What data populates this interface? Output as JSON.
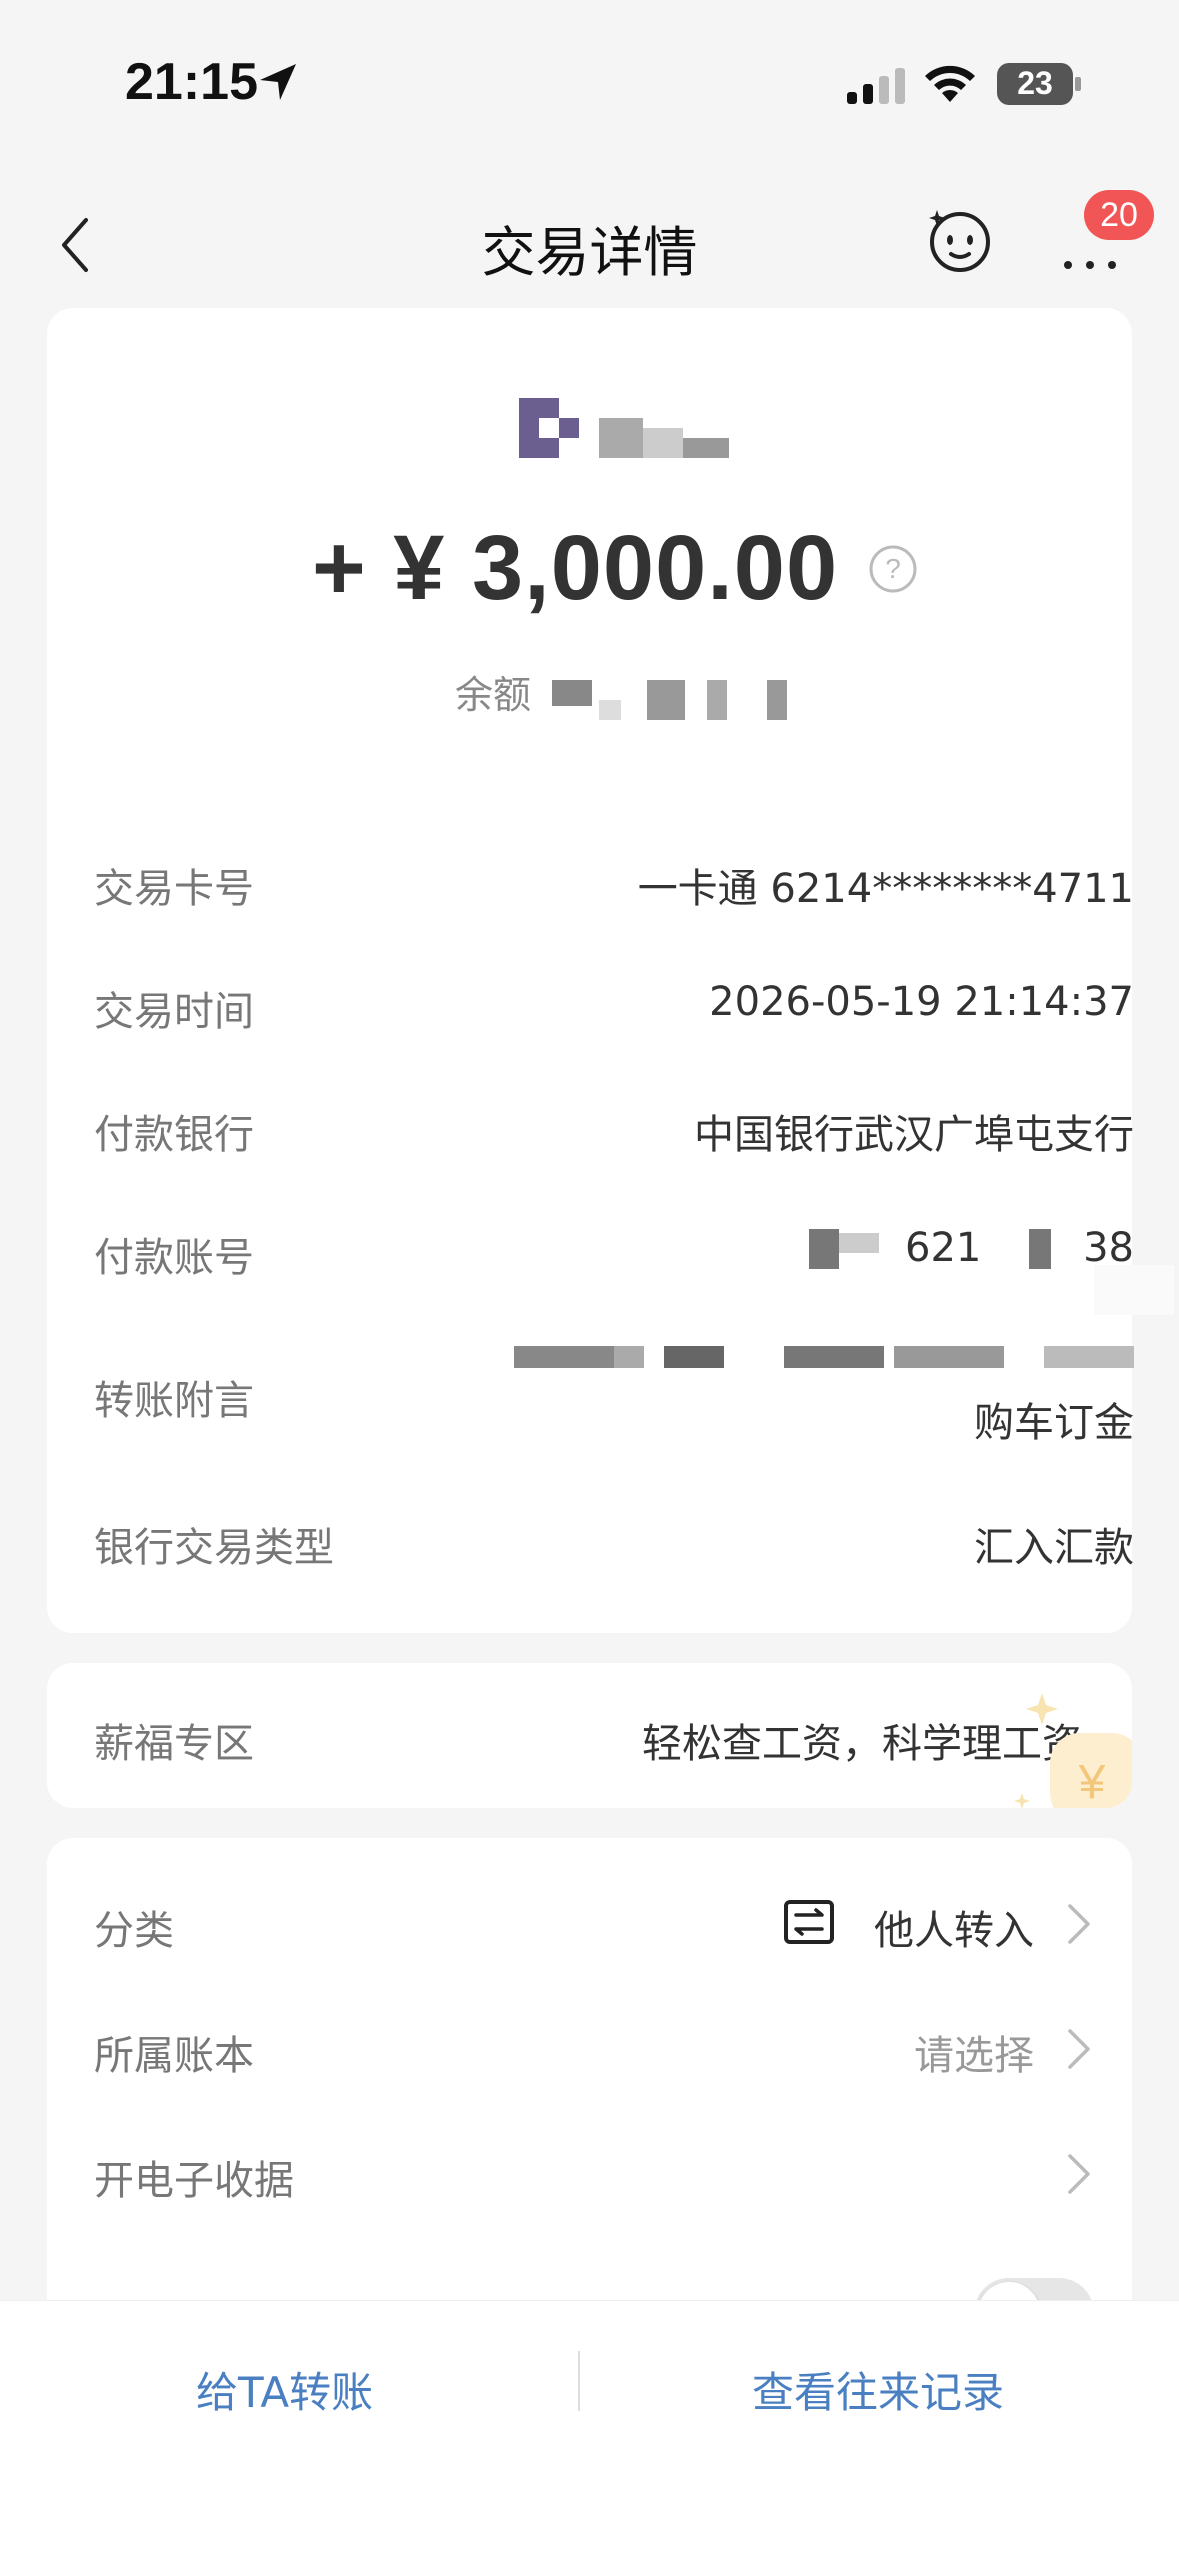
{
  "status_bar": {
    "time": "21:15",
    "battery": "23"
  },
  "nav": {
    "title": "交易详情",
    "badge_count": "20"
  },
  "transaction": {
    "amount": "+ ¥ 3,000.00",
    "balance_label": "余额",
    "details": [
      {
        "label": "交易卡号",
        "value": "一卡通 6214********4711"
      },
      {
        "label": "交易时间",
        "value": "2026-05-19 21:14:37"
      },
      {
        "label": "付款银行",
        "value": "中国银行武汉广埠屯支行"
      },
      {
        "label": "付款账号",
        "value": "621        38"
      },
      {
        "label": "转账附言",
        "value": "购车订金"
      },
      {
        "label": "银行交易类型",
        "value": "汇入汇款"
      }
    ]
  },
  "salary": {
    "label": "薪福专区",
    "value": "轻松查工资，科学理工资"
  },
  "options": {
    "category_label": "分类",
    "category_value": "他人转入",
    "ledger_label": "所属账本",
    "ledger_placeholder": "请选择",
    "receipt_label": "开电子收据"
  },
  "bottom": {
    "transfer_button": "给TA转账",
    "history_button": "查看往来记录"
  },
  "colors": {
    "accent_blue": "#4a7fc1",
    "badge_red": "#f25555",
    "logo_purple": "#6b5f8f"
  }
}
